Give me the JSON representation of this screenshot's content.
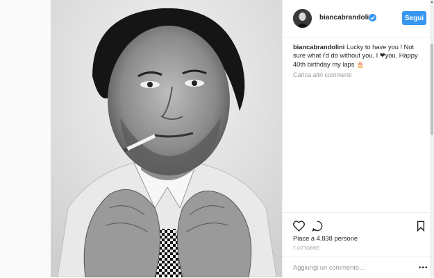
{
  "post": {
    "username": "biancabrandolini",
    "follow_label": "Segui",
    "caption_username": "biancabrandolini",
    "caption_text_1": " Lucky to have you ! Not sure what i'd do without you. I ",
    "caption_text_2": "you. Happy 40th birthday my laps ",
    "load_more": "Carica altri commenti",
    "likes": "Piace a 4.838 persone",
    "date": "7 OTTOBRE",
    "comment_placeholder": "Aggiungi un commento...",
    "more_options": "•••"
  },
  "colors": {
    "accent": "#3897f0",
    "text": "#262626",
    "muted": "#999999"
  },
  "icons": [
    "verified-badge-icon",
    "heart-icon",
    "comment-icon",
    "bookmark-icon",
    "more-options-icon",
    "cake-icon"
  ]
}
